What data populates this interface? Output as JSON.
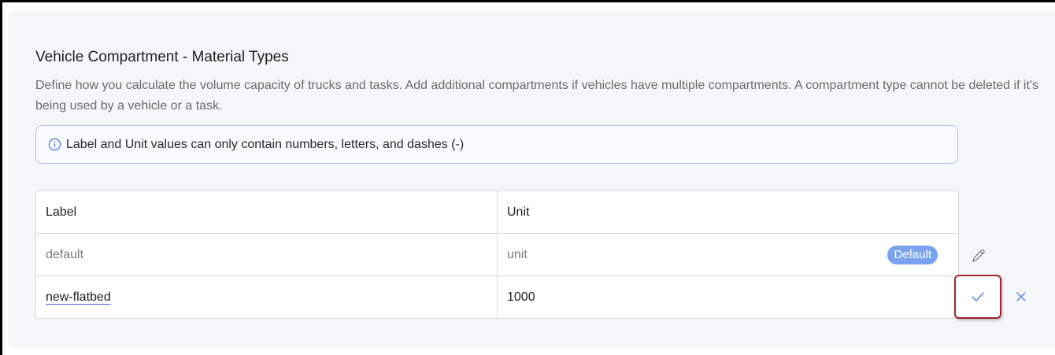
{
  "section": {
    "title": "Vehicle Compartment - Material Types",
    "description": "Define how you calculate the volume capacity of trucks and tasks. Add additional compartments if vehicles have multiple compartments. A compartment type cannot be deleted if it's being used by a vehicle or a task."
  },
  "info_banner": {
    "icon": "info-icon",
    "text": "Label and Unit values can only contain numbers, letters, and dashes (-)"
  },
  "table": {
    "headers": {
      "label": "Label",
      "unit": "Unit"
    },
    "rows": [
      {
        "label": "default",
        "unit": "unit",
        "badge": "Default",
        "action_icon": "pencil-icon"
      },
      {
        "label": "new-flatbed",
        "unit": "1000",
        "action_icons": [
          "checkmark-icon",
          "close-icon"
        ]
      }
    ]
  },
  "colors": {
    "accent": "#7aa3ef",
    "highlight_border": "#a1232b",
    "panel_bg": "#f5f6f8"
  }
}
